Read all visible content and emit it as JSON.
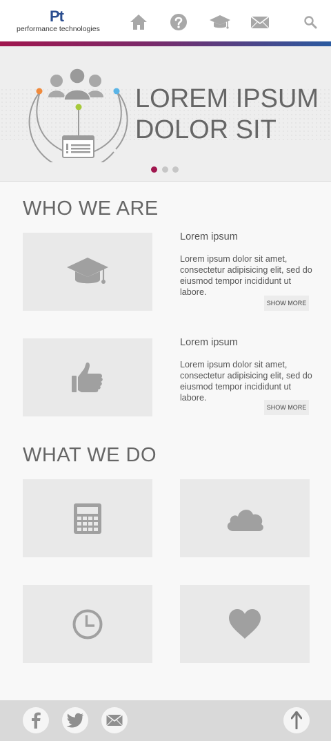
{
  "brand": {
    "mark": "Pt",
    "name": "performance technologies"
  },
  "nav": [
    {
      "icon": "home-icon"
    },
    {
      "icon": "help-icon"
    },
    {
      "icon": "graduation-cap-icon"
    },
    {
      "icon": "mail-icon"
    },
    {
      "icon": "search-icon"
    }
  ],
  "hero": {
    "title_line1": "LOREM IPSUM",
    "title_line2": "DOLOR SIT",
    "slides": 3,
    "active_slide": 1
  },
  "who_we_are": {
    "title": "WHO WE ARE",
    "items": [
      {
        "icon": "graduation-cap-icon",
        "heading": "Lorem ipsum",
        "body": "Lorem ipsum dolor sit amet, consectetur adipisicing elit, sed do eiusmod tempor incididunt ut labore.",
        "button": "SHOW MORE"
      },
      {
        "icon": "thumbs-up-icon",
        "heading": "Lorem ipsum",
        "body": "Lorem ipsum dolor sit amet, consectetur adipisicing elit, sed do eiusmod tempor incididunt ut labore.",
        "button": "SHOW MORE"
      }
    ]
  },
  "what_we_do": {
    "title": "WHAT WE DO",
    "tiles": [
      {
        "icon": "calculator-icon"
      },
      {
        "icon": "cloud-icon"
      },
      {
        "icon": "clock-icon"
      },
      {
        "icon": "heart-icon"
      }
    ]
  },
  "footer": {
    "social": [
      {
        "icon": "facebook-icon"
      },
      {
        "icon": "twitter-icon"
      },
      {
        "icon": "mail-icon"
      }
    ],
    "back_to_top": {
      "icon": "arrow-up-icon"
    }
  },
  "colors": {
    "accent": "#a0164e",
    "brand_blue": "#2a4d8f",
    "stripe_end": "#2a5aa0",
    "icon_gray": "#a8a8a8",
    "dot_orange": "#f08a3c",
    "dot_blue": "#5ab4e6",
    "dot_green": "#a6c93a"
  }
}
